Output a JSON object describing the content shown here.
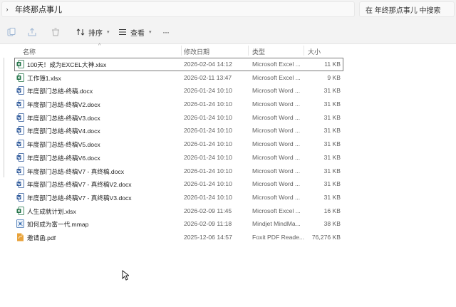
{
  "address": {
    "chevron": "›",
    "folder": "年终那点事儿"
  },
  "search": {
    "placeholder": "在 年终那点事儿 中搜索"
  },
  "toolbar": {
    "sort_label": "排序",
    "view_label": "查看",
    "more": "···",
    "icons": [
      "copy-icon",
      "share-icon",
      "delete-icon",
      "sort-icon",
      "view-icon",
      "more-icon"
    ]
  },
  "columns": {
    "name": "名称",
    "date": "修改日期",
    "type": "类型",
    "size": "大小"
  },
  "files": [
    {
      "name": "100天！成为EXCEL大神.xlsx",
      "date": "2026-02-04 14:12",
      "type": "Microsoft Excel ...",
      "size": "11 KB",
      "kind": "excel",
      "selected": true
    },
    {
      "name": "工作簿1.xlsx",
      "date": "2026-02-11 13:47",
      "type": "Microsoft Excel ...",
      "size": "9 KB",
      "kind": "excel"
    },
    {
      "name": "年度部门总结-终稿.docx",
      "date": "2026-01-24 10:10",
      "type": "Microsoft Word ...",
      "size": "31 KB",
      "kind": "word"
    },
    {
      "name": "年度部门总结-终稿V2.docx",
      "date": "2026-01-24 10:10",
      "type": "Microsoft Word ...",
      "size": "31 KB",
      "kind": "word"
    },
    {
      "name": "年度部门总结-终稿V3.docx",
      "date": "2026-01-24 10:10",
      "type": "Microsoft Word ...",
      "size": "31 KB",
      "kind": "word"
    },
    {
      "name": "年度部门总结-终稿V4.docx",
      "date": "2026-01-24 10:10",
      "type": "Microsoft Word ...",
      "size": "31 KB",
      "kind": "word"
    },
    {
      "name": "年度部门总结-终稿V5.docx",
      "date": "2026-01-24 10:10",
      "type": "Microsoft Word ...",
      "size": "31 KB",
      "kind": "word"
    },
    {
      "name": "年度部门总结-终稿V6.docx",
      "date": "2026-01-24 10:10",
      "type": "Microsoft Word ...",
      "size": "31 KB",
      "kind": "word"
    },
    {
      "name": "年度部门总结-终稿V7 - 真终稿.docx",
      "date": "2026-01-24 10:10",
      "type": "Microsoft Word ...",
      "size": "31 KB",
      "kind": "word"
    },
    {
      "name": "年度部门总结-终稿V7 - 真终稿V2.docx",
      "date": "2026-01-24 10:10",
      "type": "Microsoft Word ...",
      "size": "31 KB",
      "kind": "word"
    },
    {
      "name": "年度部门总结-终稿V7 - 真终稿V3.docx",
      "date": "2026-01-24 10:10",
      "type": "Microsoft Word ...",
      "size": "31 KB",
      "kind": "word"
    },
    {
      "name": "人生成就计划.xlsx",
      "date": "2026-02-09 11:45",
      "type": "Microsoft Excel ...",
      "size": "16 KB",
      "kind": "excel"
    },
    {
      "name": "如何成为富一代.mmap",
      "date": "2026-02-09 11:18",
      "type": "Mindjet MindMa...",
      "size": "38 KB",
      "kind": "mindmap"
    },
    {
      "name": "邀请函.pdf",
      "date": "2025-12-06 14:57",
      "type": "Foxit PDF Reade...",
      "size": "76,276 KB",
      "kind": "pdf"
    }
  ],
  "colors": {
    "excel": "#1d7044",
    "word": "#2b579a",
    "mindmap": "#3a6fb0",
    "pdf": "#e8a23a",
    "toolbar_bg": "#f3f3f3"
  }
}
